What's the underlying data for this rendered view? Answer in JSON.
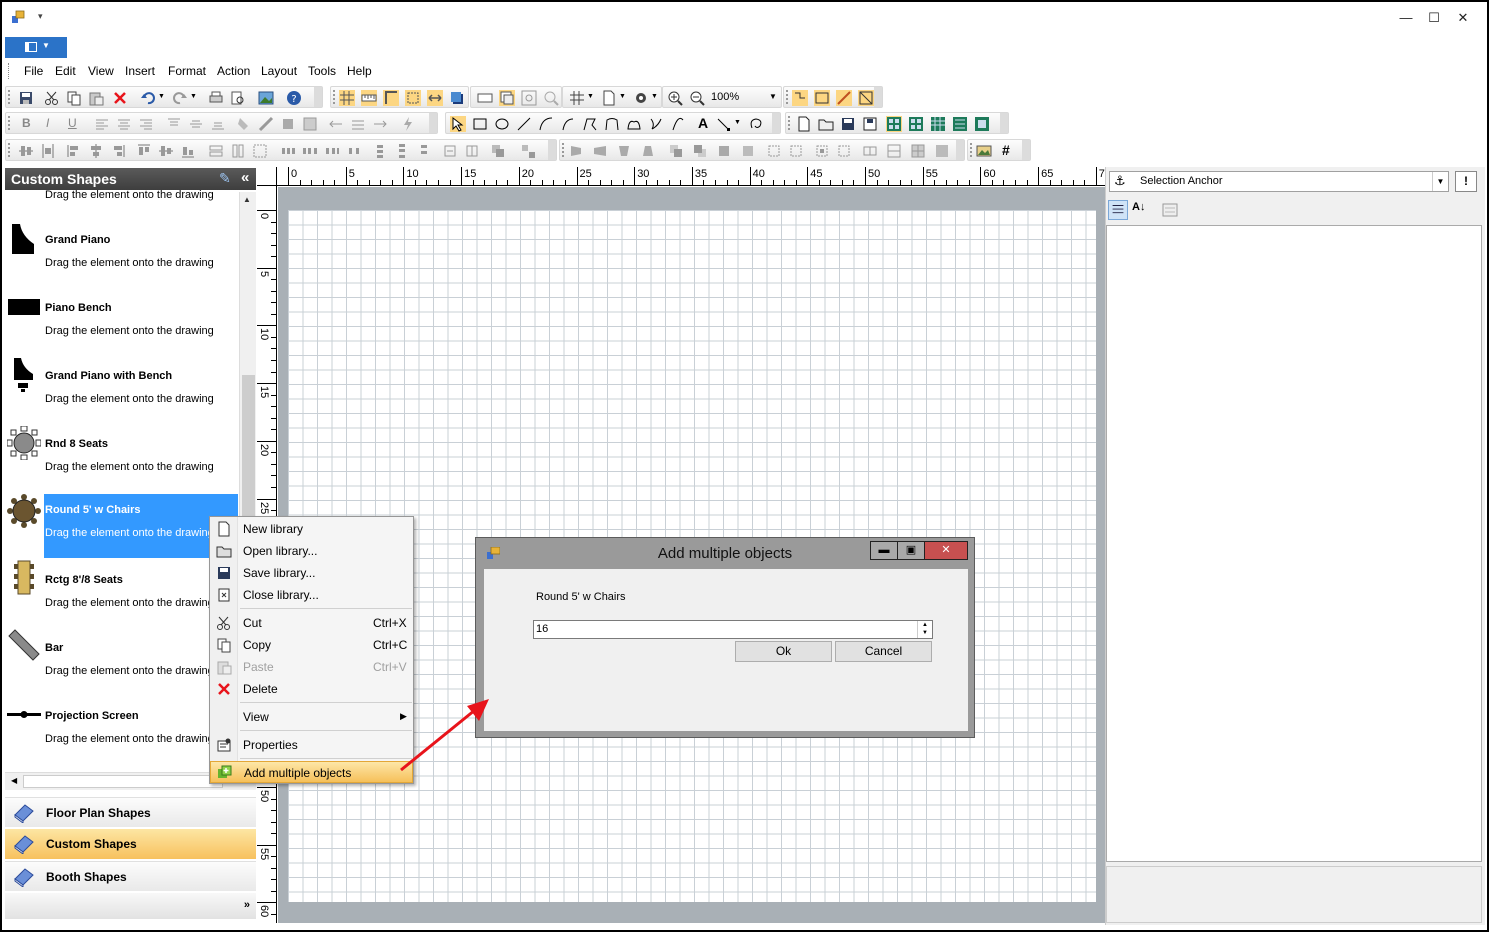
{
  "titlebar": {
    "qa_arrow": "▾",
    "minimize": "—",
    "maximize": "☐",
    "close": "✕"
  },
  "menubar": [
    "File",
    "Edit",
    "View",
    "Insert",
    "Format",
    "Action",
    "Layout",
    "Tools",
    "Help"
  ],
  "toolbar": {
    "zoom": "100%"
  },
  "left_panel": {
    "title": "Custom Shapes",
    "collapse": "«",
    "items": [
      {
        "name": "",
        "desc": "Drag the element onto the drawing"
      },
      {
        "name": "Grand Piano",
        "desc": "Drag the element onto the drawing"
      },
      {
        "name": "Piano Bench",
        "desc": "Drag the element onto the drawing"
      },
      {
        "name": "Grand Piano with Bench",
        "desc": "Drag the element onto the drawing"
      },
      {
        "name": "Rnd 8 Seats",
        "desc": "Drag the element onto the drawing"
      },
      {
        "name": "Round 5' w Chairs",
        "desc": "Drag the element onto the drawing"
      },
      {
        "name": "Rctg 8'/8 Seats",
        "desc": "Drag the element onto the drawing"
      },
      {
        "name": "Bar",
        "desc": "Drag the element onto the drawing"
      },
      {
        "name": "Projection Screen",
        "desc": "Drag the element onto the drawing"
      }
    ],
    "selected_index": 5,
    "categories": [
      "Floor Plan Shapes",
      "Custom Shapes",
      "Booth Shapes"
    ],
    "active_category": "Custom Shapes",
    "more": "»"
  },
  "ruler": {
    "h": [
      "0",
      "5",
      "10",
      "15",
      "20",
      "25",
      "30",
      "35",
      "40",
      "45",
      "50",
      "55",
      "60",
      "65",
      "7"
    ],
    "v": [
      "0",
      "5",
      "10",
      "15",
      "20",
      "25",
      "30",
      "35",
      "40",
      "45",
      "50",
      "55",
      "60"
    ]
  },
  "right_panel": {
    "selection": "Selection Anchor",
    "warn": "!"
  },
  "context_menu": {
    "items": [
      {
        "label": "New library",
        "shortcut": ""
      },
      {
        "label": "Open library...",
        "shortcut": ""
      },
      {
        "label": "Save library...",
        "shortcut": ""
      },
      {
        "label": "Close library...",
        "shortcut": ""
      },
      {
        "label": "Cut",
        "shortcut": "Ctrl+X"
      },
      {
        "label": "Copy",
        "shortcut": "Ctrl+C"
      },
      {
        "label": "Paste",
        "shortcut": "Ctrl+V"
      },
      {
        "label": "Delete",
        "shortcut": ""
      },
      {
        "label": "View",
        "shortcut": ""
      },
      {
        "label": "Properties",
        "shortcut": ""
      },
      {
        "label": "Add multiple objects",
        "shortcut": ""
      }
    ],
    "submenu_arrow": "▶"
  },
  "dialog": {
    "title": "Add multiple objects",
    "label": "Round 5' w Chairs",
    "value": "16",
    "ok": "Ok",
    "cancel": "Cancel",
    "btn_min": "▬",
    "btn_max": "▣",
    "btn_close": "✕"
  },
  "colors": {
    "accent": "#3399ff",
    "highlight": "#f6c05a",
    "arrow": "#e8141b",
    "close": "#c75050"
  }
}
